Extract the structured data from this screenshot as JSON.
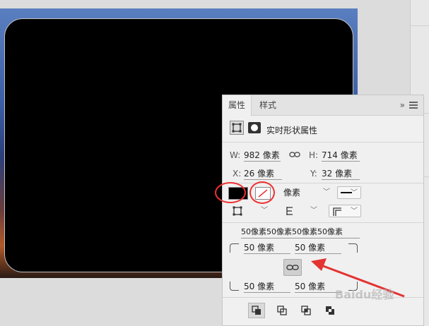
{
  "panel": {
    "tabs": [
      {
        "label": "属性",
        "active": true
      },
      {
        "label": "样式",
        "active": false
      }
    ],
    "collapse_glyph": "»",
    "menu_icon": "menu-icon",
    "header_title": "实时形状属性",
    "size": {
      "w_label": "W:",
      "w_value": "982 像素",
      "h_label": "H:",
      "h_value": "714 像素",
      "link_icon": "link-icon"
    },
    "position": {
      "x_label": "X:",
      "x_value": "26 像素",
      "y_label": "Y:",
      "y_value": "32 像素"
    },
    "appearance": {
      "fill_color": "#000000",
      "stroke_icon": "no-stroke-icon",
      "stroke_width": "像素",
      "stroke_style": "solid-line"
    },
    "corners": {
      "summary": "50像素50像素50像素50像素",
      "top_left": "50 像素",
      "top_right": "50 像素",
      "bottom_left": "50 像素",
      "bottom_right": "50 像素",
      "link_icon": "link-icon"
    }
  },
  "colors": {
    "accent_annotation": "#e33333",
    "panel_bg": "#f0f0f0",
    "shape_fill": "#000000"
  },
  "watermark": "Baidu经验"
}
